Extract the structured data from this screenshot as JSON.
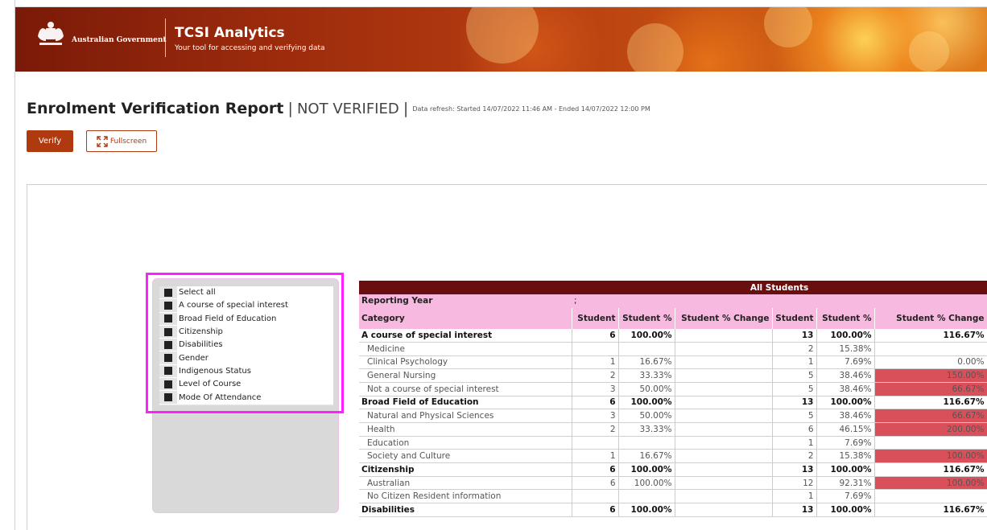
{
  "header": {
    "gov_name": "Australian Government",
    "app_title": "TCSI Analytics",
    "app_subtitle": "Your tool for accessing and verifying data"
  },
  "report": {
    "title": "Enrolment Verification Report",
    "separator": "|",
    "status": "NOT VERIFIED",
    "refresh": "Data refresh: Started 14/07/2022 11:46 AM - Ended 14/07/2022 12:00 PM"
  },
  "buttons": {
    "verify": "Verify",
    "fullscreen": "Fullscreen"
  },
  "slicer": {
    "items": [
      "Select all",
      "A course of special interest",
      "Broad Field of Education",
      "Citizenship",
      "Disabilities",
      "Gender",
      "Indigenous Status",
      "Level of Course",
      "Mode Of Attendance"
    ]
  },
  "table": {
    "group_header": "All Students",
    "reporting_year_label": "Reporting Year",
    "reporting_year_marker": ";",
    "category_label": "Category",
    "columns": [
      "Student",
      "Student %",
      "Student % Change",
      "Student",
      "Student %",
      "Student % Change"
    ],
    "rows": [
      {
        "type": "group",
        "category": "A course of special interest",
        "s1": "6",
        "p1": "100.00%",
        "c1": "",
        "s2": "13",
        "p2": "100.00%",
        "c2": "116.67%",
        "red": false
      },
      {
        "type": "item",
        "category": "Medicine",
        "s1": "",
        "p1": "",
        "c1": "",
        "s2": "2",
        "p2": "15.38%",
        "c2": "",
        "red": false
      },
      {
        "type": "item",
        "category": "Clinical Psychology",
        "s1": "1",
        "p1": "16.67%",
        "c1": "",
        "s2": "1",
        "p2": "7.69%",
        "c2": "0.00%",
        "red": false
      },
      {
        "type": "item",
        "category": "General Nursing",
        "s1": "2",
        "p1": "33.33%",
        "c1": "",
        "s2": "5",
        "p2": "38.46%",
        "c2": "150.00%",
        "red": true
      },
      {
        "type": "item",
        "category": "Not a course of special interest",
        "s1": "3",
        "p1": "50.00%",
        "c1": "",
        "s2": "5",
        "p2": "38.46%",
        "c2": "66.67%",
        "red": true
      },
      {
        "type": "group",
        "category": "Broad Field of Education",
        "s1": "6",
        "p1": "100.00%",
        "c1": "",
        "s2": "13",
        "p2": "100.00%",
        "c2": "116.67%",
        "red": false
      },
      {
        "type": "item",
        "category": "Natural and Physical Sciences",
        "s1": "3",
        "p1": "50.00%",
        "c1": "",
        "s2": "5",
        "p2": "38.46%",
        "c2": "66.67%",
        "red": true
      },
      {
        "type": "item",
        "category": "Health",
        "s1": "2",
        "p1": "33.33%",
        "c1": "",
        "s2": "6",
        "p2": "46.15%",
        "c2": "200.00%",
        "red": true
      },
      {
        "type": "item",
        "category": "Education",
        "s1": "",
        "p1": "",
        "c1": "",
        "s2": "1",
        "p2": "7.69%",
        "c2": "",
        "red": false
      },
      {
        "type": "item",
        "category": "Society and Culture",
        "s1": "1",
        "p1": "16.67%",
        "c1": "",
        "s2": "2",
        "p2": "15.38%",
        "c2": "100.00%",
        "red": true
      },
      {
        "type": "group",
        "category": "Citizenship",
        "s1": "6",
        "p1": "100.00%",
        "c1": "",
        "s2": "13",
        "p2": "100.00%",
        "c2": "116.67%",
        "red": false
      },
      {
        "type": "item",
        "category": "Australian",
        "s1": "6",
        "p1": "100.00%",
        "c1": "",
        "s2": "12",
        "p2": "92.31%",
        "c2": "100.00%",
        "red": true
      },
      {
        "type": "item",
        "category": "No Citizen Resident information",
        "s1": "",
        "p1": "",
        "c1": "",
        "s2": "1",
        "p2": "7.69%",
        "c2": "",
        "red": false
      },
      {
        "type": "group",
        "category": "Disabilities",
        "s1": "6",
        "p1": "100.00%",
        "c1": "",
        "s2": "13",
        "p2": "100.00%",
        "c2": "116.67%",
        "red": false
      }
    ]
  },
  "colors": {
    "accent": "#b03a10",
    "table_header": "#6a0f0f",
    "table_pink": "#f7b9e0",
    "highlight_red": "#d9505a",
    "selection_outline": "#ff1fff"
  }
}
